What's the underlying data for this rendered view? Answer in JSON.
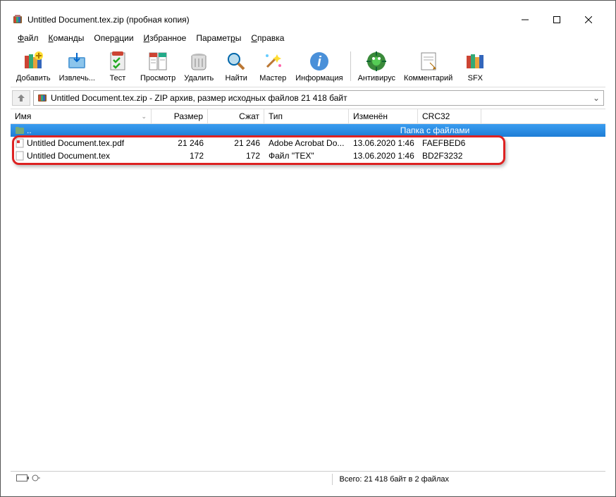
{
  "window": {
    "title": "Untitled Document.tex.zip (пробная копия)"
  },
  "menu": {
    "file": "Файл",
    "commands": "Команды",
    "operations": "Операции",
    "favorites": "Избранное",
    "options": "Параметры",
    "help": "Справка"
  },
  "toolbar": {
    "add": "Добавить",
    "extract": "Извлечь...",
    "test": "Тест",
    "view": "Просмотр",
    "delete": "Удалить",
    "find": "Найти",
    "wizard": "Мастер",
    "info": "Информация",
    "antivirus": "Антивирус",
    "comment": "Комментарий",
    "sfx": "SFX"
  },
  "path": {
    "text": "Untitled Document.tex.zip - ZIP архив, размер исходных файлов 21 418 байт"
  },
  "columns": {
    "name": "Имя",
    "size": "Размер",
    "packed": "Сжат",
    "type": "Тип",
    "modified": "Изменён",
    "crc": "CRC32"
  },
  "rows": {
    "parent": {
      "name": "..",
      "type": "Папка с файлами"
    },
    "r1": {
      "name": "Untitled Document.tex.pdf",
      "size": "21 246",
      "packed": "21 246",
      "type": "Adobe Acrobat Do...",
      "modified": "13.06.2020 1:46",
      "crc": "FAEFBED6"
    },
    "r2": {
      "name": "Untitled Document.tex",
      "size": "172",
      "packed": "172",
      "type": "Файл \"TEX\"",
      "modified": "13.06.2020 1:46",
      "crc": "BD2F3232"
    }
  },
  "status": {
    "total": "Всего: 21 418 байт в 2 файлах"
  }
}
